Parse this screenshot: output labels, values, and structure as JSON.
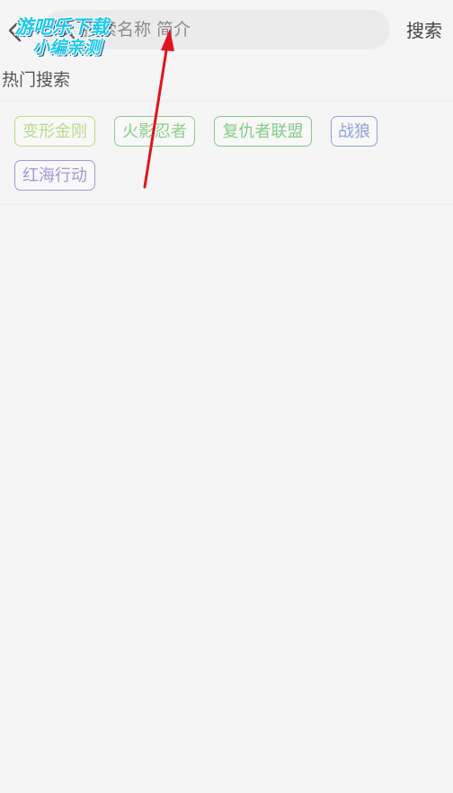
{
  "header": {
    "search_placeholder": "搜索名称 简介",
    "search_button_label": "搜索"
  },
  "hot_search": {
    "title": "热门搜索",
    "tags": [
      {
        "label": "变形金刚",
        "color": "#b8dc8c"
      },
      {
        "label": "火影忍者",
        "color": "#8ccf8a"
      },
      {
        "label": "复仇者联盟",
        "color": "#86c98a"
      },
      {
        "label": "战狼",
        "color": "#8ea2d8"
      },
      {
        "label": "红海行动",
        "color": "#a995d8"
      }
    ]
  },
  "watermark": {
    "line1": "游吧乐下载",
    "line2": "小编亲测"
  },
  "icons": {
    "back": "chevron-left-icon",
    "search": "search-icon",
    "annotation": "red-arrow"
  },
  "colors": {
    "background": "#f5f5f5",
    "search_box": "#ebebeb",
    "annotation_arrow": "#e0141e",
    "watermark": "#1cc8e8"
  }
}
